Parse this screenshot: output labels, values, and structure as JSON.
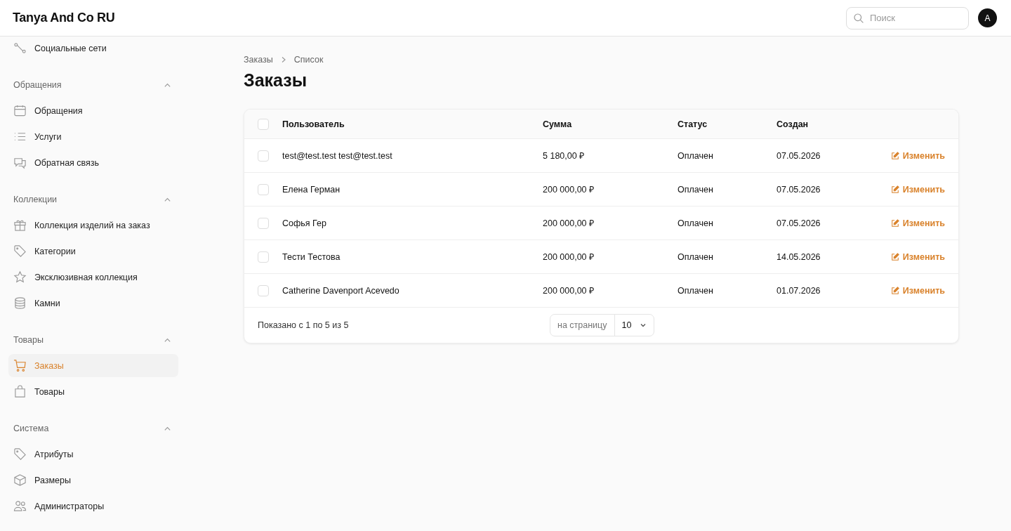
{
  "header": {
    "brand": "Tanya And Co RU",
    "search": {
      "placeholder": "Поиск"
    },
    "avatar": "A"
  },
  "sidebar": {
    "top_item": {
      "label": "Социальные сети",
      "selected": false
    },
    "groups": [
      {
        "title": "Обращения",
        "expanded": true,
        "items": [
          {
            "label": "Обращения",
            "selected": false
          },
          {
            "label": "Услуги",
            "selected": false
          },
          {
            "label": "Обратная связь",
            "selected": false
          }
        ]
      },
      {
        "title": "Коллекции",
        "expanded": true,
        "items": [
          {
            "label": "Коллекция изделий на заказ",
            "selected": false
          },
          {
            "label": "Категории",
            "selected": false
          },
          {
            "label": "Эксклюзивная коллекция",
            "selected": false
          },
          {
            "label": "Камни",
            "selected": false
          }
        ]
      },
      {
        "title": "Товары",
        "expanded": true,
        "items": [
          {
            "label": "Заказы",
            "selected": true
          },
          {
            "label": "Товары",
            "selected": false
          }
        ]
      },
      {
        "title": "Система",
        "expanded": true,
        "items": [
          {
            "label": "Атрибуты",
            "selected": false
          },
          {
            "label": "Размеры",
            "selected": false
          },
          {
            "label": "Администраторы",
            "selected": false
          }
        ]
      }
    ]
  },
  "breadcrumbs": [
    "Заказы",
    "Список"
  ],
  "title": "Заказы",
  "table": {
    "select_all": {
      "checked": false
    },
    "columns": [
      "Пользователь",
      "Сумма",
      "Статус",
      "Создан"
    ],
    "rows": [
      {
        "checked": false,
        "user": "test@test.test test@test.test",
        "sum": "5 180,00 ₽",
        "status": "Оплачен",
        "created": "07.05.2026",
        "action": "Изменить"
      },
      {
        "checked": false,
        "user": "Елена Герман",
        "sum": "200 000,00 ₽",
        "status": "Оплачен",
        "created": "07.05.2026",
        "action": "Изменить"
      },
      {
        "checked": false,
        "user": "Софья Гер",
        "sum": "200 000,00 ₽",
        "status": "Оплачен",
        "created": "07.05.2026",
        "action": "Изменить"
      },
      {
        "checked": false,
        "user": "Тести Тестова",
        "sum": "200 000,00 ₽",
        "status": "Оплачен",
        "created": "14.05.2026",
        "action": "Изменить"
      },
      {
        "checked": false,
        "user": "Catherine Davenport Acevedo",
        "sum": "200 000,00 ₽",
        "status": "Оплачен",
        "created": "01.07.2026",
        "action": "Изменить"
      }
    ],
    "footer": {
      "summary": "Показано с 1 по 5 из 5",
      "per_page_label": "на страницу",
      "per_page_value": "10"
    }
  }
}
